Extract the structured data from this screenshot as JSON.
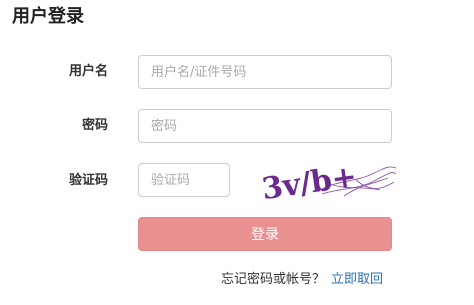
{
  "page": {
    "title": "用户登录"
  },
  "form": {
    "username": {
      "label": "用户名",
      "placeholder": "用户名/证件号码",
      "value": ""
    },
    "password": {
      "label": "密码",
      "placeholder": "密码",
      "value": ""
    },
    "captcha": {
      "label": "验证码",
      "placeholder": "验证码",
      "value": "",
      "image_text": "3v/b+"
    },
    "submit_label": "登录"
  },
  "recover": {
    "prompt": "忘记密码或帐号？",
    "link_label": "立即取回"
  },
  "colors": {
    "button_bg": "#e99191",
    "link": "#2a6fb5",
    "captcha_ink": "#6b2a8c"
  }
}
